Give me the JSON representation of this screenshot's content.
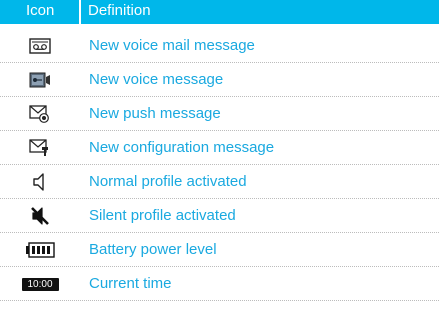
{
  "table": {
    "header": {
      "icon_label": "Icon",
      "definition_label": "Definition"
    },
    "rows": [
      {
        "icon": "voicemail-icon",
        "definition": "New voice mail message"
      },
      {
        "icon": "voice-message-icon",
        "definition": "New voice message"
      },
      {
        "icon": "push-message-icon",
        "definition": "New push message"
      },
      {
        "icon": "configuration-message-icon",
        "definition": "New configuration message"
      },
      {
        "icon": "speaker-icon",
        "definition": "Normal profile activated"
      },
      {
        "icon": "speaker-muted-icon",
        "definition": "Silent profile activated"
      },
      {
        "icon": "battery-icon",
        "definition": "Battery power level"
      },
      {
        "icon": "clock-icon",
        "definition": "Current time",
        "icon_text": "10:00"
      }
    ]
  },
  "colors": {
    "header_bg": "#00b7ea",
    "header_text": "#ffffff",
    "definition_text": "#1aa9e0"
  }
}
